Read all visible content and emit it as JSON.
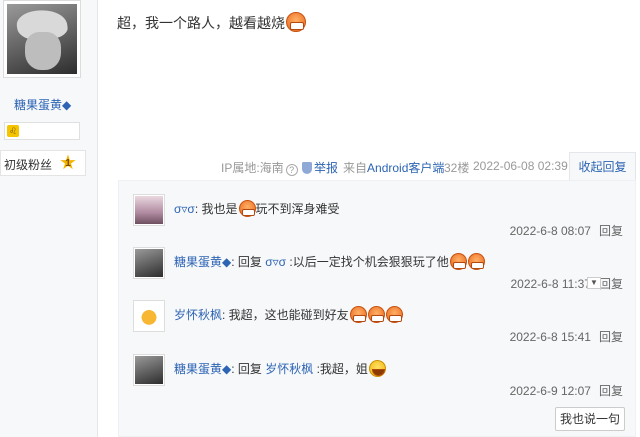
{
  "sidebar": {
    "username": "糖果蛋黄◆",
    "badge_icon": "♌",
    "level_label": "初级粉丝",
    "level_number": "1"
  },
  "post": {
    "content": "超，我一个路人，越看越烧",
    "emoji": "grin-emoji"
  },
  "meta": {
    "ip": "IP属地:海南",
    "report": "举报",
    "from_prefix": "来自",
    "client": "Android客户端",
    "floor": "32楼",
    "time": "2022-06-08 02:39",
    "collapse": "收起回复"
  },
  "replies": [
    {
      "name": "σ▿σ",
      "text": ": 我也是",
      "text_after": "玩不到浑身难受",
      "date": "2022-6-8 08:07",
      "reply_btn": "回复"
    },
    {
      "name": "糖果蛋黄◆",
      "text": ": 回复 ",
      "target": "σ▿σ",
      "text_after": " :以后一定找个机会狠狠玩了他",
      "date": "2022-6-8 11:37",
      "reply_btn": "回复"
    },
    {
      "name": "岁怀秋枫",
      "text": ": 我超，这也能碰到好友",
      "date": "2022-6-8 15:41",
      "reply_btn": "回复"
    },
    {
      "name": "糖果蛋黄◆",
      "text": ": 回复 ",
      "target": "岁怀秋枫",
      "text_after": " :我超，姐",
      "date": "2022-6-9 12:07",
      "reply_btn": "回复"
    }
  ],
  "say_button": "我也说一句",
  "colors": {
    "link": "#2d64b3",
    "meta": "#999999",
    "panel": "#f7f8fa"
  }
}
